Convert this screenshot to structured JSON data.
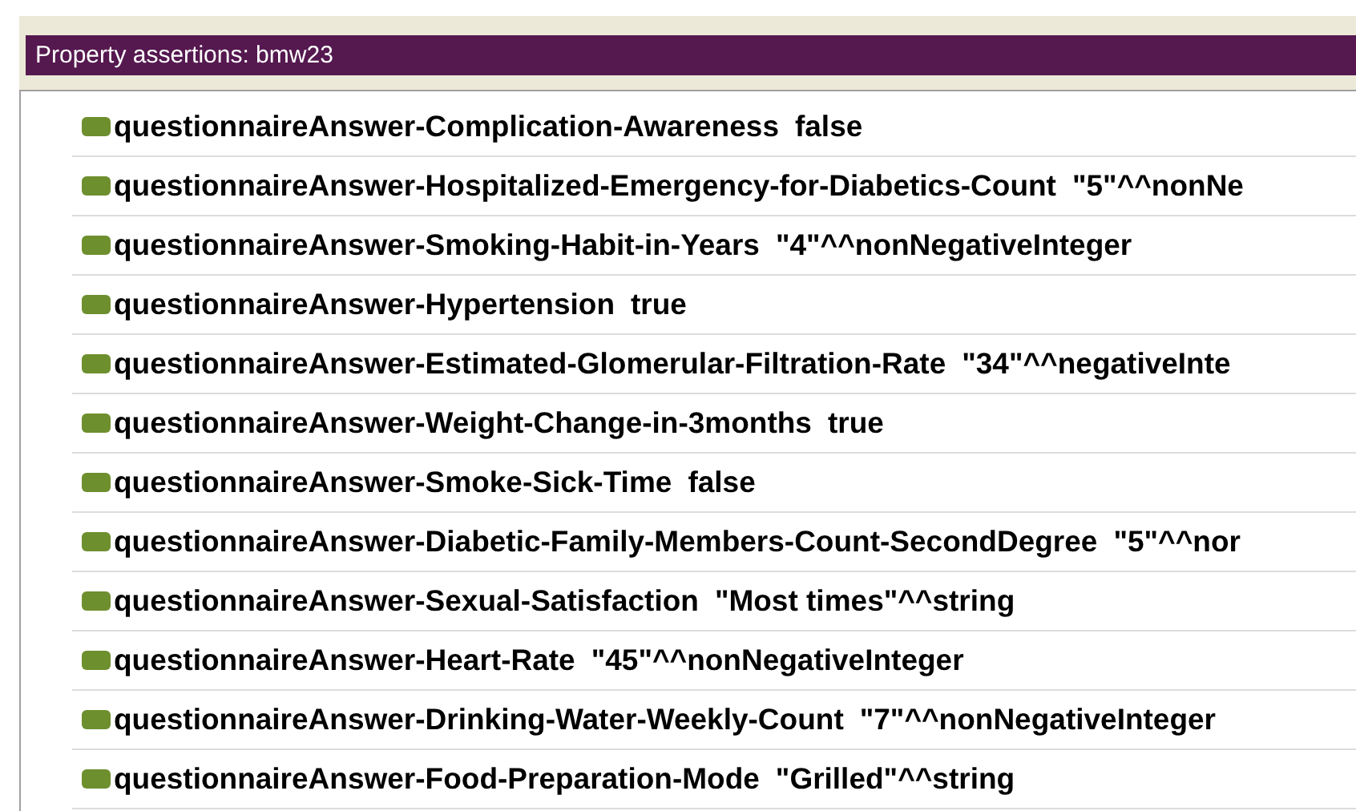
{
  "panel": {
    "title": "Property assertions: bmw23"
  },
  "assertions": [
    {
      "property": "questionnaireAnswer-Complication-Awareness",
      "value": "false"
    },
    {
      "property": "questionnaireAnswer-Hospitalized-Emergency-for-Diabetics-Count",
      "value": "\"5\"^^nonNe"
    },
    {
      "property": "questionnaireAnswer-Smoking-Habit-in-Years",
      "value": "\"4\"^^nonNegativeInteger"
    },
    {
      "property": "questionnaireAnswer-Hypertension",
      "value": "true"
    },
    {
      "property": "questionnaireAnswer-Estimated-Glomerular-Filtration-Rate",
      "value": "\"34\"^^negativeInte"
    },
    {
      "property": "questionnaireAnswer-Weight-Change-in-3months",
      "value": "true"
    },
    {
      "property": "questionnaireAnswer-Smoke-Sick-Time",
      "value": "false"
    },
    {
      "property": "questionnaireAnswer-Diabetic-Family-Members-Count-SecondDegree",
      "value": "\"5\"^^nor"
    },
    {
      "property": "questionnaireAnswer-Sexual-Satisfaction",
      "value": "\"Most times\"^^string"
    },
    {
      "property": "questionnaireAnswer-Heart-Rate",
      "value": "\"45\"^^nonNegativeInteger"
    },
    {
      "property": "questionnaireAnswer-Drinking-Water-Weekly-Count",
      "value": "\"7\"^^nonNegativeInteger"
    },
    {
      "property": "questionnaireAnswer-Food-Preparation-Mode",
      "value": "\"Grilled\"^^string"
    }
  ]
}
